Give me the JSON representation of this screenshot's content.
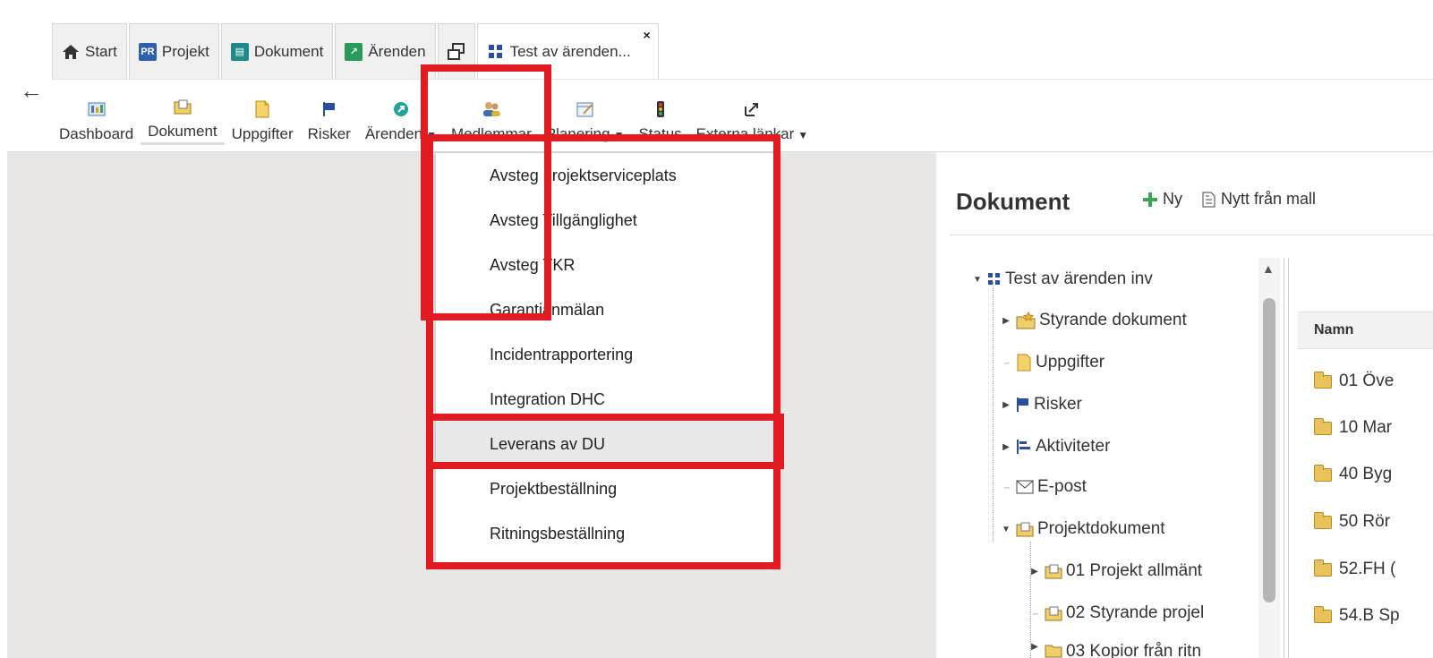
{
  "tabs": [
    {
      "label": "Start",
      "icon": "home-icon"
    },
    {
      "label": "Projekt",
      "icon": "project-icon"
    },
    {
      "label": "Dokument",
      "icon": "document-icon"
    },
    {
      "label": "Ärenden",
      "icon": "cases-icon"
    },
    {
      "label": "",
      "icon": "windows-icon"
    },
    {
      "label": "Test av ärenden...",
      "icon": "grid-icon",
      "active": true
    }
  ],
  "toolbar": {
    "items": [
      {
        "label": "Dashboard",
        "icon": "dashboard-icon"
      },
      {
        "label": "Dokument",
        "icon": "folder-icon"
      },
      {
        "label": "Uppgifter",
        "icon": "tasks-icon"
      },
      {
        "label": "Risker",
        "icon": "flag-icon"
      },
      {
        "label": "Ärenden",
        "icon": "cases-icon",
        "caret": "▼"
      },
      {
        "label": "Medlemmar",
        "icon": "members-icon"
      },
      {
        "label": "Planering",
        "icon": "planning-icon",
        "caret": "▼"
      },
      {
        "label": "Status",
        "icon": "traffic-light-icon"
      },
      {
        "label": "Externa länkar",
        "icon": "external-link-icon",
        "caret": "▼"
      }
    ]
  },
  "dropdown": {
    "items": [
      "Avsteg projektserviceplats",
      "Avsteg Tillgänglighet",
      "Avsteg TKR",
      "Garantianmälan",
      "Incidentrapportering",
      "Integration DHC",
      "Leverans av DU",
      "Projektbeställning",
      "Ritningsbeställning"
    ],
    "highlighted": "Leverans av DU"
  },
  "panel": {
    "title": "Dokument",
    "actions": {
      "new": "Ny",
      "from_template": "Nytt från mall"
    },
    "tree": {
      "root": "Test av ärenden inv",
      "nodes": [
        "Styrande dokument",
        "Uppgifter",
        "Risker",
        "Aktiviteter",
        "E-post",
        "Projektdokument",
        "01 Projekt allmänt",
        "02 Styrande projel",
        "03 Kopior från ritn"
      ]
    },
    "grid": {
      "header": "Namn",
      "rows": [
        "01 Öve",
        "10 Mar",
        "40 Byg",
        "50 Rör",
        "52.FH (",
        "54.B Sp"
      ]
    }
  },
  "colors": {
    "highlight_red": "#e21b22",
    "accent_green": "#3aa655",
    "tab_blue": "#1f5fa8"
  }
}
